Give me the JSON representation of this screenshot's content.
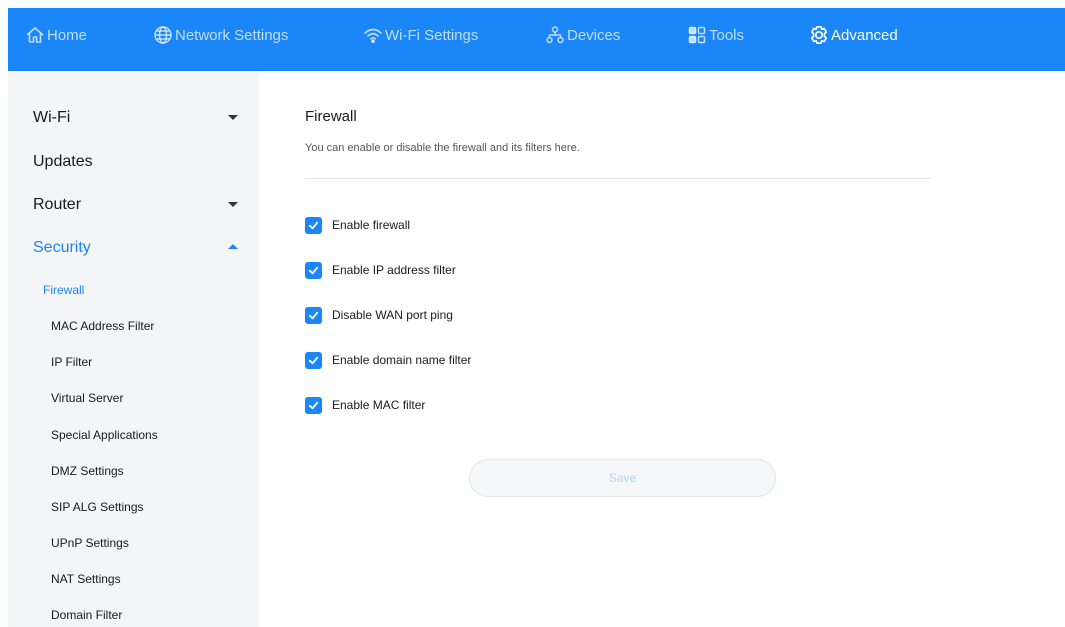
{
  "nav": {
    "items": [
      {
        "label": "Home",
        "icon": "home-icon"
      },
      {
        "label": "Network Settings",
        "icon": "globe-icon"
      },
      {
        "label": "Wi-Fi Settings",
        "icon": "wifi-icon"
      },
      {
        "label": "Devices",
        "icon": "devices-icon"
      },
      {
        "label": "Tools",
        "icon": "tools-icon"
      },
      {
        "label": "Advanced",
        "icon": "gear-icon"
      }
    ],
    "active": "Advanced",
    "bg_color": "#1a86f7"
  },
  "sidebar": {
    "items": [
      {
        "label": "Wi-Fi",
        "expandable": true,
        "expanded": false
      },
      {
        "label": "Updates",
        "expandable": false
      },
      {
        "label": "Router",
        "expandable": true,
        "expanded": false
      },
      {
        "label": "Security",
        "expandable": true,
        "expanded": true
      }
    ],
    "subitems": [
      {
        "label": "Firewall",
        "active": true
      },
      {
        "label": "MAC Address Filter"
      },
      {
        "label": "IP Filter"
      },
      {
        "label": "Virtual Server"
      },
      {
        "label": "Special Applications"
      },
      {
        "label": "DMZ Settings"
      },
      {
        "label": "SIP ALG Settings"
      },
      {
        "label": "UPnP Settings"
      },
      {
        "label": "NAT Settings"
      },
      {
        "label": "Domain Filter"
      }
    ]
  },
  "content": {
    "title": "Firewall",
    "description": "You can enable or disable the firewall and its filters here.",
    "options": [
      {
        "label": "Enable firewall",
        "checked": true
      },
      {
        "label": "Enable IP address filter",
        "checked": true
      },
      {
        "label": "Disable WAN port ping",
        "checked": true
      },
      {
        "label": "Enable domain name filter",
        "checked": true
      },
      {
        "label": "Enable MAC filter",
        "checked": true
      }
    ],
    "save_label": "Save"
  },
  "colors": {
    "accent": "#1a86f7"
  }
}
